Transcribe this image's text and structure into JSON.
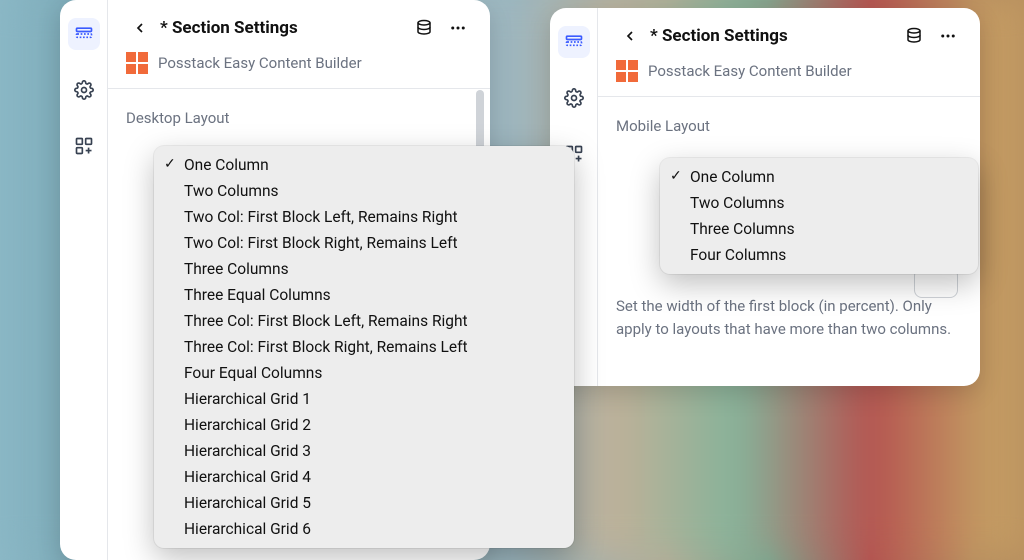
{
  "header": {
    "title": "* Section Settings",
    "subtitle": "Posstack Easy Content Builder"
  },
  "left": {
    "section_label": "Desktop Layout",
    "selected": "One Column",
    "options": [
      "One Column",
      "Two Columns",
      "Two Col: First Block Left, Remains Right",
      "Two Col: First Block Right, Remains Left",
      "Three Columns",
      "Three Equal Columns",
      "Three Col: First Block Left, Remains Right",
      "Three Col: First Block Right, Remains Left",
      "Four Equal Columns",
      "Hierarchical Grid 1",
      "Hierarchical Grid 2",
      "Hierarchical Grid 3",
      "Hierarchical Grid 4",
      "Hierarchical Grid 5",
      "Hierarchical Grid 6"
    ]
  },
  "right": {
    "section_label": "Mobile Layout",
    "selected": "One Column",
    "options": [
      "One Column",
      "Two Columns",
      "Three Columns",
      "Four Columns"
    ],
    "help_text": "Set the width of the first block (in percent). Only apply to layouts that have more than two columns."
  }
}
